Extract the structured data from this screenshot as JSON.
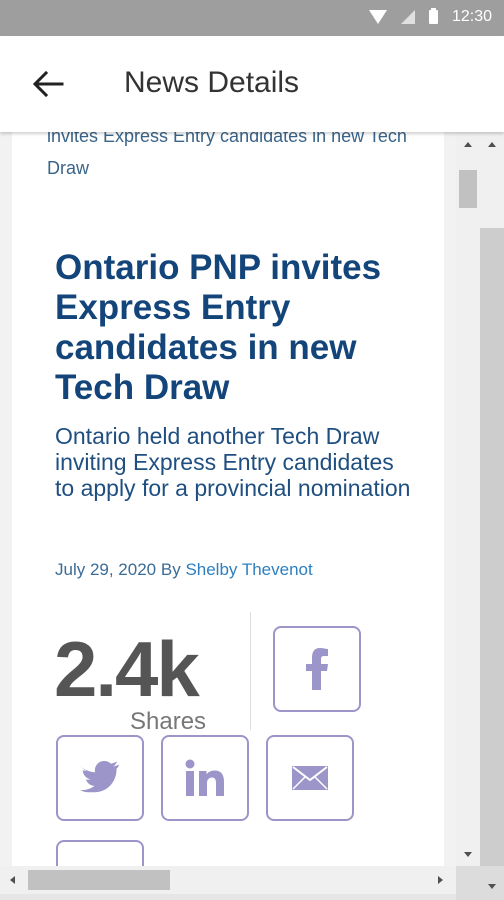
{
  "status_bar": {
    "time": "12:30",
    "icons": [
      "wifi-icon",
      "signal-icon",
      "battery-icon"
    ]
  },
  "app_bar": {
    "title": "News Details",
    "back_icon": "arrow-left-icon"
  },
  "article": {
    "prev_title": "invites Express Entry candidates in new Tech Draw",
    "headline": "Ontario PNP invites Express Entry candidates in new Tech Draw",
    "subheadline": "Ontario held another Tech Draw inviting Express Entry candidates to apply for a provincial nomination",
    "date": "July 29, 2020 By",
    "author": "Shelby Thevenot"
  },
  "shares": {
    "count": "2.4k",
    "label": "Shares",
    "buttons": [
      "facebook-icon",
      "twitter-icon",
      "linkedin-icon",
      "mail-icon"
    ]
  },
  "colors": {
    "headline": "#13457a",
    "share_border": "#9b95c9",
    "author_link": "#2d7fc1"
  }
}
